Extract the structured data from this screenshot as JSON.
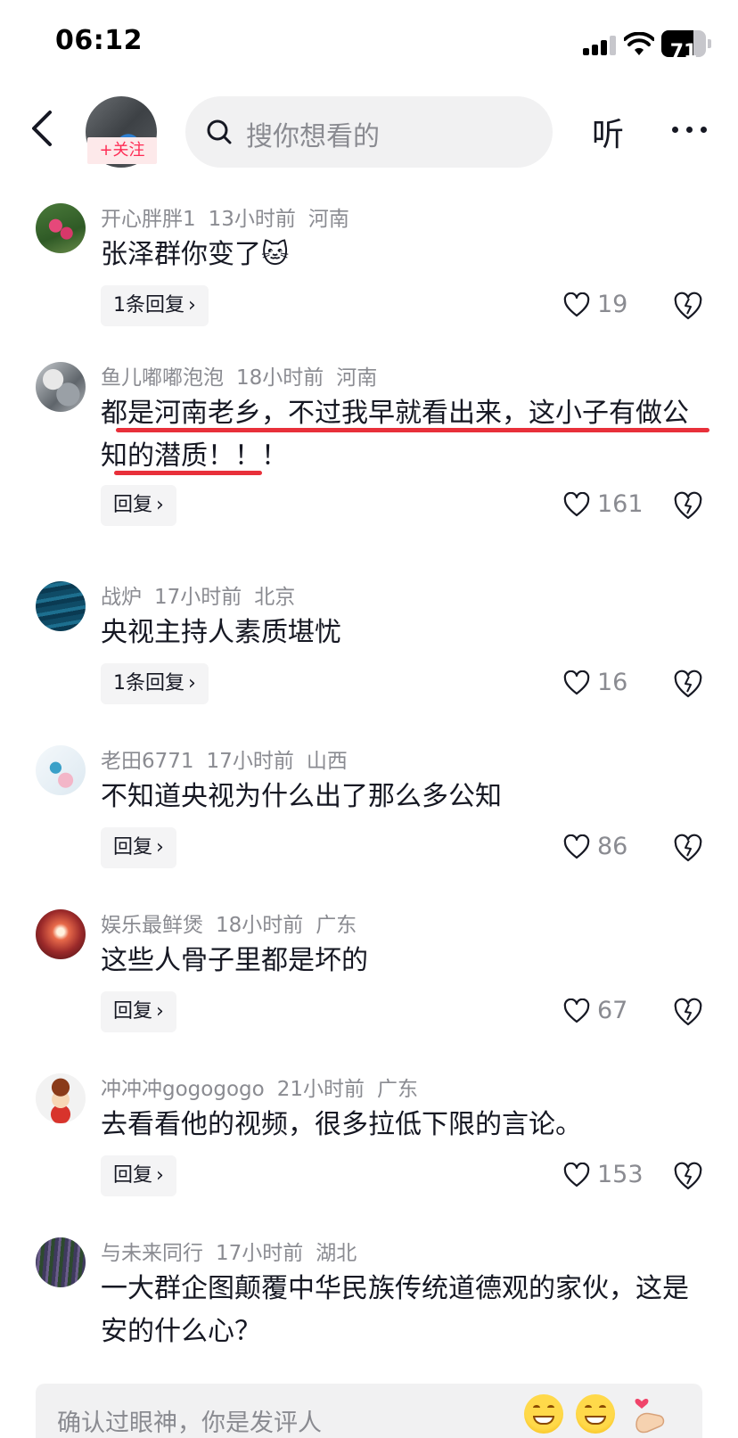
{
  "status_bar": {
    "time": "06:12",
    "battery": "71",
    "battery_level": 0.71
  },
  "header": {
    "follow_label": "+关注",
    "search_placeholder": "搜你想看的",
    "listen_label": "听"
  },
  "colors": {
    "accent": "#fe2c55",
    "underline": "#e8303a",
    "meta_gray": "#8a8b91",
    "chip_bg": "#f4f4f5"
  },
  "comments": [
    {
      "user": "开心胖胖1",
      "time": "13小时前",
      "location": "河南",
      "text": "张泽群你变了🐱",
      "reply_label": "1条回复",
      "likes": "19"
    },
    {
      "user": "鱼儿嘟嘟泡泡",
      "time": "18小时前",
      "location": "河南",
      "text": "都是河南老乡，不过我早就看出来，这小子有做公知的潜质！！！",
      "reply_label": "回复",
      "likes": "161"
    },
    {
      "user": "战炉",
      "time": "17小时前",
      "location": "北京",
      "text": "央视主持人素质堪忧",
      "reply_label": "1条回复",
      "likes": "16"
    },
    {
      "user": "老田6771",
      "time": "17小时前",
      "location": "山西",
      "text": "不知道央视为什么出了那么多公知",
      "reply_label": "回复",
      "likes": "86"
    },
    {
      "user": "娱乐最鲜煲",
      "time": "18小时前",
      "location": "广东",
      "text": "这些人骨子里都是坏的",
      "reply_label": "回复",
      "likes": "67"
    },
    {
      "user": "冲冲冲gogogogo",
      "time": "21小时前",
      "location": "广东",
      "text": "去看看他的视频，很多拉低下限的言论。",
      "reply_label": "回复",
      "likes": "153"
    },
    {
      "user": "与未来同行",
      "time": "17小时前",
      "location": "湖北",
      "text": "一大群企图颠覆中华民族传统道德观的家伙，这是安的什么心？"
    }
  ],
  "bottom_bar": {
    "placeholder": "确认过眼神，你是发评人"
  }
}
